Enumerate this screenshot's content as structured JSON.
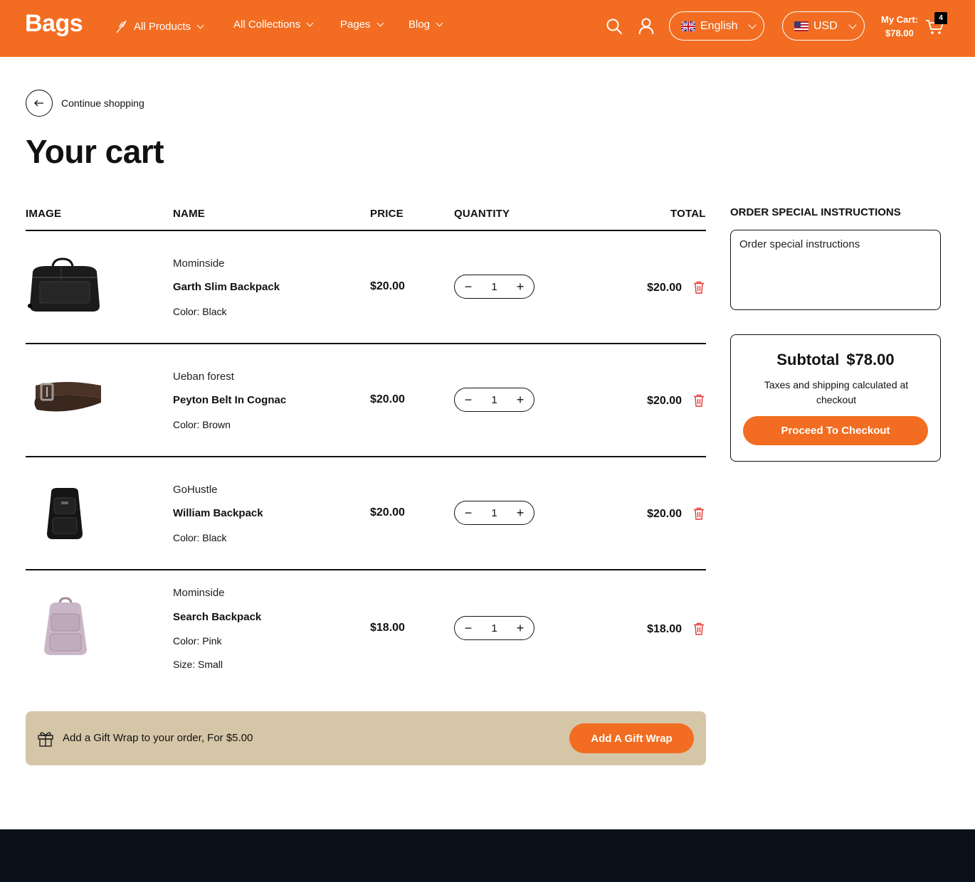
{
  "header": {
    "logo": "Bags",
    "nav": [
      {
        "label": "All Products"
      },
      {
        "label": "All Collections"
      },
      {
        "label": "Pages"
      },
      {
        "label": "Blog"
      }
    ],
    "language": "English",
    "currency": "USD",
    "cart_label": "My Cart:",
    "cart_amount": "$78.00",
    "cart_count": "4",
    "accent_color": "#f26d21"
  },
  "back": {
    "label": "Continue shopping"
  },
  "page_title": "Your cart",
  "table": {
    "columns": [
      "IMAGE",
      "NAME",
      "PRICE",
      "QUANTITY",
      "TOTAL"
    ],
    "items": [
      {
        "vendor": "Mominside",
        "name": "Garth Slim Backpack",
        "options": [
          {
            "key": "Color:",
            "value": "Black"
          }
        ],
        "price": "$20.00",
        "qty": "1",
        "total": "$20.00",
        "image": "black-duffel-bag"
      },
      {
        "vendor": "Ueban forest",
        "name": "Peyton Belt In Cognac",
        "options": [
          {
            "key": "Color:",
            "value": "Brown"
          }
        ],
        "price": "$20.00",
        "qty": "1",
        "total": "$20.00",
        "image": "brown-belt"
      },
      {
        "vendor": "GoHustle",
        "name": "William Backpack",
        "options": [
          {
            "key": "Color:",
            "value": "Black"
          }
        ],
        "price": "$20.00",
        "qty": "1",
        "total": "$20.00",
        "image": "black-backpack"
      },
      {
        "vendor": "Mominside",
        "name": "Search Backpack",
        "options": [
          {
            "key": "Color:",
            "value": "Pink"
          },
          {
            "key": "Size:",
            "value": "Small"
          }
        ],
        "price": "$18.00",
        "qty": "1",
        "total": "$18.00",
        "image": "pink-backpack"
      }
    ]
  },
  "gift": {
    "text": "Add a Gift Wrap to your order, For $5.00",
    "button": "Add A Gift Wrap",
    "bg_color": "#d5c6a8"
  },
  "instructions": {
    "title": "ORDER SPECIAL INSTRUCTIONS",
    "placeholder": "Order special instructions"
  },
  "summary": {
    "subtotal_label": "Subtotal",
    "subtotal_value": "$78.00",
    "note": "Taxes and shipping calculated at checkout",
    "checkout": "Proceed To Checkout"
  }
}
